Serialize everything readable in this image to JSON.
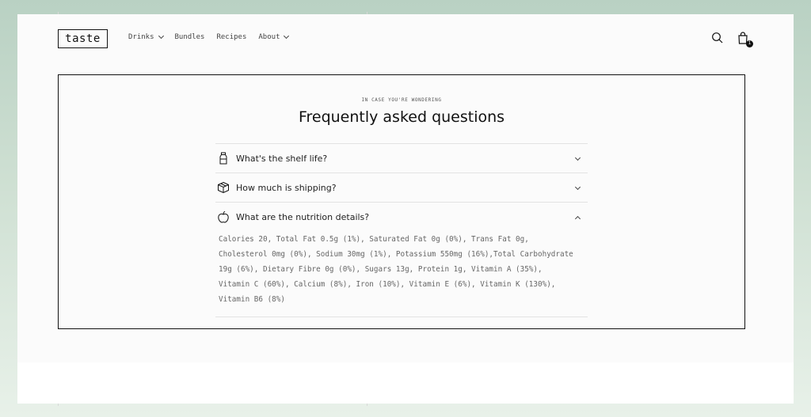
{
  "header": {
    "logo": "taste",
    "nav": [
      {
        "label": "Drinks",
        "has_dropdown": true
      },
      {
        "label": "Bundles",
        "has_dropdown": false
      },
      {
        "label": "Recipes",
        "has_dropdown": false
      },
      {
        "label": "About",
        "has_dropdown": true
      }
    ],
    "search_icon": "search-icon",
    "cart_icon": "shopping-bag-icon",
    "cart_count": "1"
  },
  "faq": {
    "eyebrow": "IN CASE YOU'RE WONDERING",
    "title": "Frequently asked questions",
    "items": [
      {
        "icon": "bottle-icon",
        "question": "What's the shelf life?",
        "expanded": false,
        "answer": ""
      },
      {
        "icon": "box-icon",
        "question": "How much is shipping?",
        "expanded": false,
        "answer": ""
      },
      {
        "icon": "apple-icon",
        "question": "What are the nutrition details?",
        "expanded": true,
        "answer": "Calories 20, Total Fat 0.5g (1%), Saturated Fat 0g (0%), Trans Fat 0g, Cholesterol 0mg (0%), Sodium 30mg (1%), Potassium 550mg (16%),Total Carbohydrate 19g (6%), Dietary Fibre 0g (0%), Sugars 13g, Protein 1g, Vitamin A (35%), Vitamin C (60%), Calcium (8%), Iron (10%), Vitamin E (6%), Vitamin K (130%), Vitamin B6 (8%)"
      }
    ]
  },
  "colors": {
    "background_gradient_top": "#b9d1c3",
    "page": "#fbfbfb",
    "text": "#111111",
    "muted_text": "#666666",
    "divider": "#e3e3e3"
  }
}
